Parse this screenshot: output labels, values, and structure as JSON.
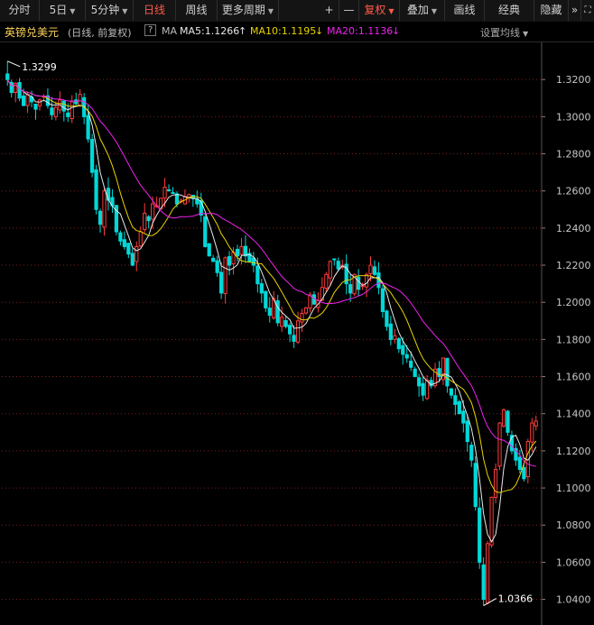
{
  "toolbar": {
    "tabs": [
      {
        "label": "分时",
        "dropdown": false,
        "active": false
      },
      {
        "label": "5日",
        "dropdown": true,
        "active": false
      },
      {
        "label": "5分钟",
        "dropdown": true,
        "active": false
      },
      {
        "label": "日线",
        "dropdown": false,
        "active": true
      },
      {
        "label": "周线",
        "dropdown": false,
        "active": false
      },
      {
        "label": "更多周期",
        "dropdown": true,
        "active": false
      }
    ],
    "tools": [
      {
        "label": "+",
        "dropdown": false,
        "active": false
      },
      {
        "label": "—",
        "dropdown": false,
        "active": false
      },
      {
        "label": "复权",
        "dropdown": true,
        "active": true
      },
      {
        "label": "叠加",
        "dropdown": true,
        "active": false
      },
      {
        "label": "画线",
        "dropdown": false,
        "active": false
      },
      {
        "label": "经典",
        "dropdown": false,
        "active": false
      },
      {
        "label": "隐藏",
        "dropdown": false,
        "active": false
      }
    ],
    "expand_icon": "double-chevron-right-icon",
    "fullscreen_icon": "fullscreen-icon"
  },
  "title_bar": {
    "name": "英镑兑美元",
    "period": "(日线, 前复权)",
    "help": "?",
    "ma_label": "MA",
    "ma5": "MA5:1.1266",
    "ma5_arrow": "↑",
    "ma10": "MA10:1.1195",
    "ma10_arrow": "↓",
    "ma20": "MA20:1.1136",
    "ma20_arrow": "↓",
    "settings": "设置均线"
  },
  "colors": {
    "up": "#ff3c3c",
    "down": "#00d8d8",
    "ma5": "#e8e8e8",
    "ma10": "#e8d400",
    "ma20": "#ee22ee",
    "grid": "#7a1f1f",
    "axis_text": "#c8c8c8"
  },
  "chart_data": {
    "type": "candlestick",
    "instrument": "英镑兑美元",
    "y_ticks": [
      "1.3200",
      "1.3000",
      "1.2800",
      "1.2600",
      "1.2400",
      "1.2200",
      "1.2000",
      "1.1800",
      "1.1600",
      "1.1400",
      "1.1200",
      "1.1000",
      "1.0800",
      "1.0600",
      "1.0400"
    ],
    "ylim": [
      1.033,
      1.34
    ],
    "grid": true,
    "high_label": "1.3299",
    "low_label": "1.0366",
    "ma_lines": [
      "MA5",
      "MA10",
      "MA20"
    ],
    "close_path": [
      1.32,
      1.313,
      1.318,
      1.31,
      1.306,
      1.312,
      1.308,
      1.304,
      1.309,
      1.311,
      1.306,
      1.301,
      1.305,
      1.309,
      1.303,
      1.3,
      1.308,
      1.307,
      1.312,
      1.3,
      1.288,
      1.27,
      1.25,
      1.242,
      1.26,
      1.255,
      1.252,
      1.238,
      1.233,
      1.23,
      1.226,
      1.22,
      1.23,
      1.238,
      1.248,
      1.244,
      1.253,
      1.252,
      1.256,
      1.262,
      1.26,
      1.259,
      1.253,
      1.255,
      1.257,
      1.258,
      1.256,
      1.253,
      1.247,
      1.23,
      1.225,
      1.222,
      1.216,
      1.205,
      1.224,
      1.22,
      1.227,
      1.225,
      1.23,
      1.225,
      1.222,
      1.22,
      1.21,
      1.205,
      1.197,
      1.193,
      1.202,
      1.189,
      1.192,
      1.187,
      1.183,
      1.179,
      1.19,
      1.194,
      1.197,
      1.204,
      1.199,
      1.201,
      1.208,
      1.215,
      1.222,
      1.223,
      1.218,
      1.22,
      1.21,
      1.205,
      1.215,
      1.207,
      1.209,
      1.215,
      1.22,
      1.215,
      1.208,
      1.195,
      1.187,
      1.18,
      1.182,
      1.175,
      1.172,
      1.17,
      1.165,
      1.16,
      1.155,
      1.15,
      1.158,
      1.155,
      1.164,
      1.16,
      1.17,
      1.155,
      1.15,
      1.145,
      1.14,
      1.135,
      1.125,
      1.115,
      1.09,
      1.06,
      1.04,
      1.07,
      1.095,
      1.11,
      1.135,
      1.142,
      1.13,
      1.12,
      1.115,
      1.11,
      1.105,
      1.125,
      1.135,
      1.136
    ]
  }
}
